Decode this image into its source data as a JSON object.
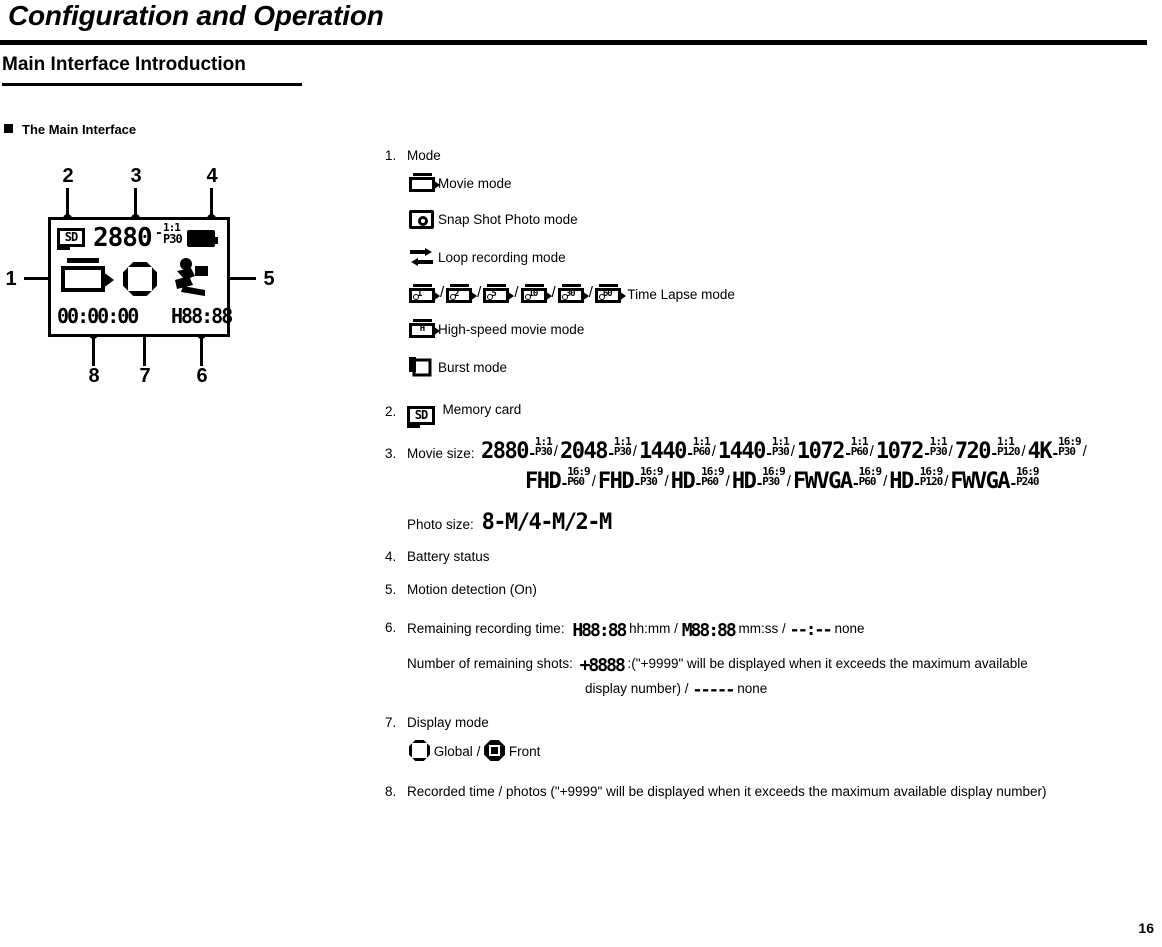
{
  "document": {
    "chapter_title": "Configuration and Operation",
    "section_title": "Main Interface Introduction",
    "subsection_title": "The Main Interface",
    "page_number": "16"
  },
  "diagram": {
    "name": "main-interface-lcd",
    "callouts": [
      "1",
      "2",
      "3",
      "4",
      "5",
      "6",
      "7",
      "8"
    ],
    "lcd": {
      "memory_card": "SD",
      "resolution": "2880",
      "aspect_ratio": "1:1",
      "frame_rate": "P30",
      "recorded_time": "00:00:00",
      "remaining_time": "H88:88"
    }
  },
  "legend": {
    "item1": {
      "number": "1.",
      "label": "Mode",
      "modes": [
        {
          "icon": "movie-camera-icon",
          "label": "Movie mode"
        },
        {
          "icon": "snapshot-camera-icon",
          "label": "Snap Shot Photo mode"
        },
        {
          "icon": "loop-arrows-icon",
          "label": "Loop recording mode"
        },
        {
          "icon": "time-lapse-icon",
          "label": "Time Lapse mode"
        },
        {
          "icon": "high-speed-icon",
          "label": "High-speed movie mode",
          "glyph": "H"
        },
        {
          "icon": "burst-icon",
          "label": "Burst mode"
        }
      ],
      "time_lapse_intervals": [
        "1",
        "2",
        "5",
        "10",
        "30",
        "60"
      ],
      "separator": "/"
    },
    "item2": {
      "number": "2.",
      "icon_text": "SD",
      "label": "Memory card"
    },
    "item3": {
      "number": "3.",
      "movie_size_label": "Movie size:",
      "photo_size_label": "Photo size:",
      "photo_size_value": "8-M/4-M/2-M",
      "separator": "/",
      "movie_sizes_row1": [
        {
          "res": "2880",
          "ratio": "1:1",
          "fps": "P30"
        },
        {
          "res": "2048",
          "ratio": "1:1",
          "fps": "P30"
        },
        {
          "res": "1440",
          "ratio": "1:1",
          "fps": "P60"
        },
        {
          "res": "1440",
          "ratio": "1:1",
          "fps": "P30"
        },
        {
          "res": "1072",
          "ratio": "1:1",
          "fps": "P60"
        },
        {
          "res": "1072",
          "ratio": "1:1",
          "fps": "P30"
        },
        {
          "res": "720",
          "ratio": "1:1",
          "fps": "P120"
        },
        {
          "res": "4K",
          "ratio": "16:9",
          "fps": "P30"
        }
      ],
      "movie_sizes_row2": [
        {
          "res": "FHD",
          "ratio": "16:9",
          "fps": "P60"
        },
        {
          "res": "FHD",
          "ratio": "16:9",
          "fps": "P30"
        },
        {
          "res": "HD",
          "ratio": "16:9",
          "fps": "P60"
        },
        {
          "res": "HD",
          "ratio": "16:9",
          "fps": "P30"
        },
        {
          "res": "FWVGA",
          "ratio": "16:9",
          "fps": "P60"
        },
        {
          "res": "HD",
          "ratio": "16:9",
          "fps": "P120"
        },
        {
          "res": "FWVGA",
          "ratio": "16:9",
          "fps": "P240"
        }
      ]
    },
    "item4": {
      "number": "4.",
      "label": "Battery status"
    },
    "item5": {
      "number": "5.",
      "label": "Motion detection (On)"
    },
    "item6": {
      "number": "6.",
      "label": "Remaining recording time:",
      "hhmm_icon": "H88:88",
      "hhmm_text": "hh:mm",
      "mmss_icon": "M88:88",
      "mmss_text": "mm:ss",
      "none_icon": "--:--",
      "none_text": "none",
      "separator": "/",
      "shots_label": "Number of remaining shots:",
      "shots_icon": "+8888",
      "shots_note": ":(\"+9999\" will be displayed when it exceeds the maximum available",
      "shots_note2": "display number) /",
      "shots_none_icon": "-----",
      "shots_none_text": "none"
    },
    "item7": {
      "number": "7.",
      "label": "Display mode",
      "global_label": "Global",
      "front_label": "Front",
      "separator": "/"
    },
    "item8": {
      "number": "8.",
      "label": "Recorded time / photos (\"+9999\" will be displayed when it exceeds the maximum available display number)"
    }
  },
  "colors": {
    "ink": "#000000",
    "paper": "#ffffff"
  }
}
